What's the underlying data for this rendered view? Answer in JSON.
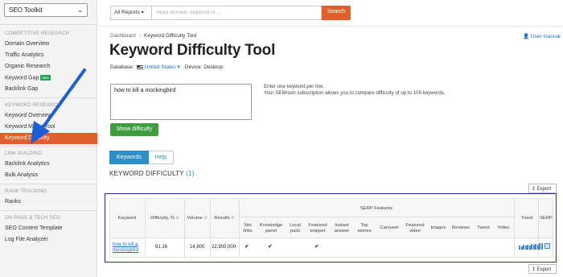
{
  "sidebar": {
    "tool_select": "SEO Toolkit",
    "sections": [
      {
        "title": "COMPETITIVE RESEARCH",
        "items": [
          "Domain Overview",
          "Traffic Analytics",
          "Organic Research",
          "Keyword Gap",
          "Backlink Gap"
        ]
      },
      {
        "title": "KEYWORD RESEARCH",
        "items": [
          "Keyword Overview",
          "Keyword Magic Tool",
          "Keyword Difficulty"
        ]
      },
      {
        "title": "LINK BUILDING",
        "items": [
          "Backlink Analytics",
          "Bulk Analysis"
        ]
      },
      {
        "title": "RANK TRACKING",
        "items": [
          "Ranks"
        ]
      },
      {
        "title": "ON PAGE & TECH SEO",
        "items": [
          "SEO Content Template",
          "Log File Analyzer"
        ]
      }
    ],
    "new_badge": "new",
    "active_item": "Keyword Difficulty"
  },
  "search": {
    "reports_select": "All Reports",
    "placeholder": "Input domain, keyword or ...",
    "button": "Search"
  },
  "breadcrumb": {
    "home": "Dashboard",
    "current": "Keyword Difficulty Tool"
  },
  "user_manual": "User manual",
  "page_title": "Keyword Difficulty Tool",
  "database": {
    "label": "Database:",
    "value": "United States",
    "device_label": "Device:",
    "device_value": "Desktop"
  },
  "input": {
    "keywords": "how to kill a mockingbird",
    "hint_line1": "Enter one keyword per line.",
    "hint_line2": "Your SEMrush subscription allows you to compare difficulty of up to 100 keywords.",
    "submit": "Show difficulty"
  },
  "tabs": [
    {
      "label": "Keywords"
    },
    {
      "label": "Help"
    }
  ],
  "results": {
    "heading": "KEYWORD DIFFICULTY",
    "count": "(1)",
    "export": "Export",
    "columns": {
      "keyword": "Keyword",
      "difficulty": "Difficulty, %",
      "volume": "Volume",
      "results": "Results",
      "serp_group": "SERP Features",
      "site_links": [
        "Site",
        "links"
      ],
      "knowledge_panel": [
        "Knowledge",
        "panel"
      ],
      "local_pack": [
        "Local",
        "pack"
      ],
      "featured_snippet": [
        "Featured",
        "snippet"
      ],
      "instant_answer": [
        "Instant",
        "answer"
      ],
      "top_stories": [
        "Top",
        "stories"
      ],
      "carousel": "Carousel",
      "featured_video": [
        "Featured",
        "video"
      ],
      "images": "Images",
      "reviews": "Reviews",
      "tweet": "Tweet",
      "video": "Video",
      "trend": "Trend",
      "serp": "SERP"
    },
    "rows": [
      {
        "keyword_line1": "how to kill a",
        "keyword_line2": "mockingbird",
        "difficulty": "91.16",
        "volume": "14,800",
        "results": "22,900,000",
        "features": [
          "site_links",
          "knowledge_panel",
          "featured_snippet"
        ],
        "trend": [
          0.6,
          0.5,
          0.7,
          0.55,
          0.65,
          0.6,
          0.8,
          0.7,
          0.75,
          0.65,
          0.9,
          0.85
        ]
      }
    ]
  },
  "colors": {
    "brand_orange": "#e05f2a",
    "active_tab": "#2d8ec9",
    "show_button": "#3e9d3e",
    "highlight_border": "#2c2ca8",
    "arrow": "#1a5fd6"
  },
  "icons": [
    "chevron-down-icon",
    "caret-down-icon",
    "us-flag-icon",
    "user-manual-icon",
    "export-icon",
    "sort-icon",
    "check-icon",
    "trend-sparkline-icon",
    "serp-snapshot-icon",
    "annotation-arrow"
  ]
}
